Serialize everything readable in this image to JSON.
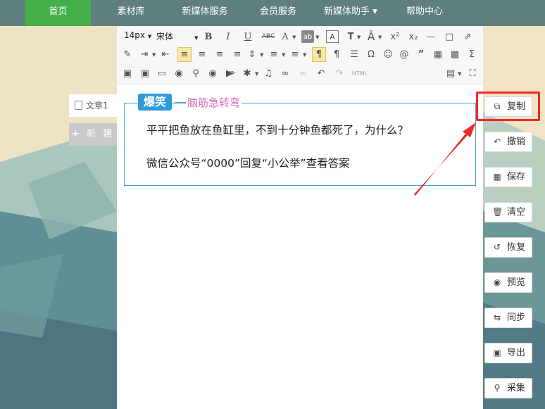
{
  "nav": {
    "items": [
      {
        "label": "首页"
      },
      {
        "label": "素材库"
      },
      {
        "label": "新媒体服务"
      },
      {
        "label": "会员服务"
      },
      {
        "label": "新媒体助手"
      },
      {
        "label": "帮助中心"
      }
    ],
    "active_color": "#43b049"
  },
  "toolbar": {
    "font_size": "14px",
    "font_family": "宋体",
    "html_label": "HTML"
  },
  "doc_tab": {
    "label": "文章1"
  },
  "new_button": {
    "label": "新 建"
  },
  "content": {
    "badge": "爆笑",
    "subtitle": "脑筋急转弯",
    "line1": "平平把鱼放在鱼缸里，不到十分钟鱼都死了，为什么？",
    "line2": "微信公众号“0000”回复“小公举”查看答案"
  },
  "actions": [
    {
      "label": "复制",
      "icon": "copy-icon"
    },
    {
      "label": "撤销",
      "icon": "undo-icon"
    },
    {
      "label": "保存",
      "icon": "save-icon"
    },
    {
      "label": "清空",
      "icon": "trash-icon"
    },
    {
      "label": "恢复",
      "icon": "restore-icon"
    },
    {
      "label": "预览",
      "icon": "eye-icon"
    },
    {
      "label": "同步",
      "icon": "sync-icon"
    },
    {
      "label": "导出",
      "icon": "export-icon"
    },
    {
      "label": "采集",
      "icon": "search-icon"
    }
  ],
  "colors": {
    "nav_bg": "#5f7f7f",
    "badge": "#2d9bd9",
    "subtitle": "#d46fb0",
    "highlight": "#f02828"
  }
}
